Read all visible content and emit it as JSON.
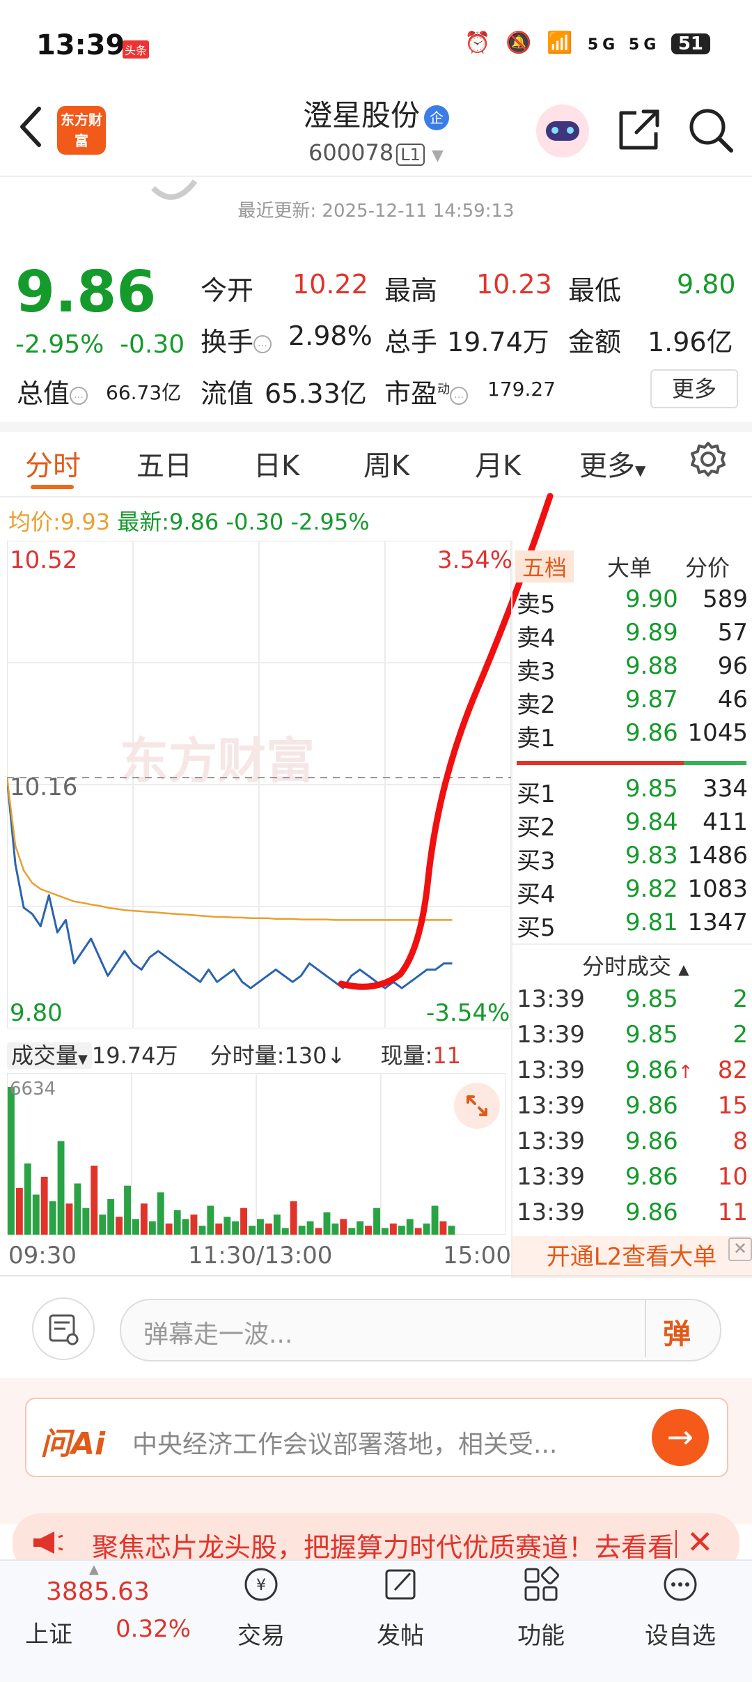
{
  "status_bar": {
    "time": "13:39",
    "badge": "头条",
    "signal": "5G 5G",
    "battery": "51"
  },
  "header": {
    "logo_text": "东方财富",
    "stock_name": "澄星股份",
    "enterprise_tag": "企",
    "stock_code": "600078",
    "level_tag": "L1",
    "last_update": "最近更新: 2025-12-11 14:59:13"
  },
  "quote": {
    "price": "9.86",
    "change_pct": "-2.95%",
    "change_amt": "-0.30",
    "open_label": "今开",
    "open": "10.22",
    "high_label": "最高",
    "high": "10.23",
    "low_label": "最低",
    "low": "9.80",
    "turnover_label": "换手",
    "turnover": "2.98%",
    "volume_label": "总手",
    "volume": "19.74万",
    "amount_label": "金额",
    "amount": "1.96亿",
    "mktcap_label": "总值",
    "mktcap": "66.73亿",
    "float_label": "流值",
    "float": "65.33亿",
    "pe_label": "市盈",
    "pe_sup": "动",
    "pe": "179.27",
    "more_button": "更多"
  },
  "tabs": [
    "分时",
    "五日",
    "日K",
    "周K",
    "月K",
    "更多"
  ],
  "intraday": {
    "avg_label": "均价:",
    "avg": "9.93",
    "latest_label": "最新:",
    "latest": "9.86",
    "latest_chg": "-0.30",
    "latest_pct": "-2.95%",
    "y_top": "10.52",
    "y_mid": "10.16",
    "y_bottom": "9.80",
    "pct_top": "3.54%",
    "pct_bottom": "-3.54%",
    "watermark": "东方财富",
    "volume_label": "成交量",
    "volume_value": "19.74万",
    "tick_vol_label": "分时量:130",
    "tick_vol_arrow": "↓",
    "current_label": "现量:",
    "current_value": "11",
    "vol_max": "6634",
    "x_labels": [
      "09:30",
      "11:30/13:00",
      "15:00"
    ]
  },
  "chart_data": {
    "type": "line",
    "title": "",
    "ylim": [
      9.8,
      10.52
    ],
    "reference": 10.16,
    "series": [
      {
        "name": "",
        "values": [
          10.16,
          10.02,
          9.95,
          9.94,
          9.92,
          9.97,
          9.91,
          9.93,
          9.86,
          9.88,
          9.9,
          9.87,
          9.84,
          9.86,
          9.88,
          9.86,
          9.85,
          9.87,
          9.88,
          9.87,
          9.86,
          9.85,
          9.84,
          9.83,
          9.85,
          9.83,
          9.84,
          9.85,
          9.83,
          9.82,
          9.83,
          9.84,
          9.85,
          9.84,
          9.83,
          9.84,
          9.86,
          9.85,
          9.84,
          9.83,
          9.82,
          9.84,
          9.85,
          9.84,
          9.83,
          9.82,
          9.83,
          9.82,
          9.83,
          9.84,
          9.85,
          9.85,
          9.86,
          9.86
        ]
      },
      {
        "name": "",
        "values": [
          10.16,
          10.05,
          10.01,
          9.99,
          9.98,
          9.975,
          9.97,
          9.965,
          9.96,
          9.958,
          9.955,
          9.953,
          9.95,
          9.948,
          9.946,
          9.945,
          9.944,
          9.943,
          9.942,
          9.941,
          9.94,
          9.939,
          9.938,
          9.937,
          9.936,
          9.935,
          9.935,
          9.934,
          9.934,
          9.933,
          9.933,
          9.933,
          9.932,
          9.932,
          9.932,
          9.931,
          9.931,
          9.931,
          9.931,
          9.93,
          9.93,
          9.93,
          9.93,
          9.93,
          9.93,
          9.93,
          9.93,
          9.93,
          9.93,
          9.93,
          9.93,
          9.93,
          9.93,
          9.93
        ]
      }
    ],
    "volume": [
      6634,
      2100,
      3200,
      1800,
      2600,
      1500,
      4200,
      1400,
      2300,
      1200,
      3100,
      900,
      1600,
      800,
      2200,
      700,
      1400,
      600,
      1900,
      500,
      1100,
      700,
      900,
      400,
      1300,
      500,
      800,
      600,
      1200,
      400,
      700,
      500,
      900,
      300,
      1500,
      400,
      600,
      300,
      1000,
      500,
      700,
      300,
      600,
      400,
      1200,
      300,
      500,
      400,
      700,
      300,
      500,
      1300,
      600,
      400
    ]
  },
  "order_book": {
    "tabs": [
      "五档",
      "大单",
      "分价"
    ],
    "sells": [
      {
        "label": "卖5",
        "price": "9.90",
        "vol": "589"
      },
      {
        "label": "卖4",
        "price": "9.89",
        "vol": "57"
      },
      {
        "label": "卖3",
        "price": "9.88",
        "vol": "96"
      },
      {
        "label": "卖2",
        "price": "9.87",
        "vol": "46"
      },
      {
        "label": "卖1",
        "price": "9.86",
        "vol": "1045"
      }
    ],
    "buys": [
      {
        "label": "买1",
        "price": "9.85",
        "vol": "334"
      },
      {
        "label": "买2",
        "price": "9.84",
        "vol": "411"
      },
      {
        "label": "买3",
        "price": "9.83",
        "vol": "1486"
      },
      {
        "label": "买4",
        "price": "9.82",
        "vol": "1083"
      },
      {
        "label": "买5",
        "price": "9.81",
        "vol": "1347"
      }
    ],
    "ticks_title": "分时成交",
    "ticks": [
      {
        "time": "13:39",
        "price": "9.85",
        "vol": "2",
        "dir": "",
        "color": "#159a2c"
      },
      {
        "time": "13:39",
        "price": "9.85",
        "vol": "2",
        "dir": "",
        "color": "#159a2c"
      },
      {
        "time": "13:39",
        "price": "9.86",
        "vol": "82",
        "dir": "↑",
        "color": "#e0342b"
      },
      {
        "time": "13:39",
        "price": "9.86",
        "vol": "15",
        "dir": "",
        "color": "#e0342b"
      },
      {
        "time": "13:39",
        "price": "9.86",
        "vol": "8",
        "dir": "",
        "color": "#e0342b"
      },
      {
        "time": "13:39",
        "price": "9.86",
        "vol": "10",
        "dir": "",
        "color": "#e0342b"
      },
      {
        "time": "13:39",
        "price": "9.86",
        "vol": "11",
        "dir": "",
        "color": "#e0342b"
      }
    ],
    "l2_promo": "开通L2查看大单"
  },
  "comment": {
    "placeholder": "弹幕走一波...",
    "danmu_label": "弹"
  },
  "ai": {
    "logo": "问Ai",
    "text": "中央经济工作会议部署落地，相关受..."
  },
  "promo": {
    "text": "聚焦芯片龙头股，把握算力时代优质赛道！去看看"
  },
  "nav": {
    "index_value": "3885.63",
    "index_name": "上证",
    "index_pct": "0.32%",
    "items": [
      "交易",
      "发帖",
      "功能",
      "设自选"
    ]
  },
  "colors": {
    "up": "#e0342b",
    "down": "#159a2c",
    "accent": "#f06a1a",
    "price_line": "#2a64b0",
    "avg_line": "#e8a030"
  }
}
